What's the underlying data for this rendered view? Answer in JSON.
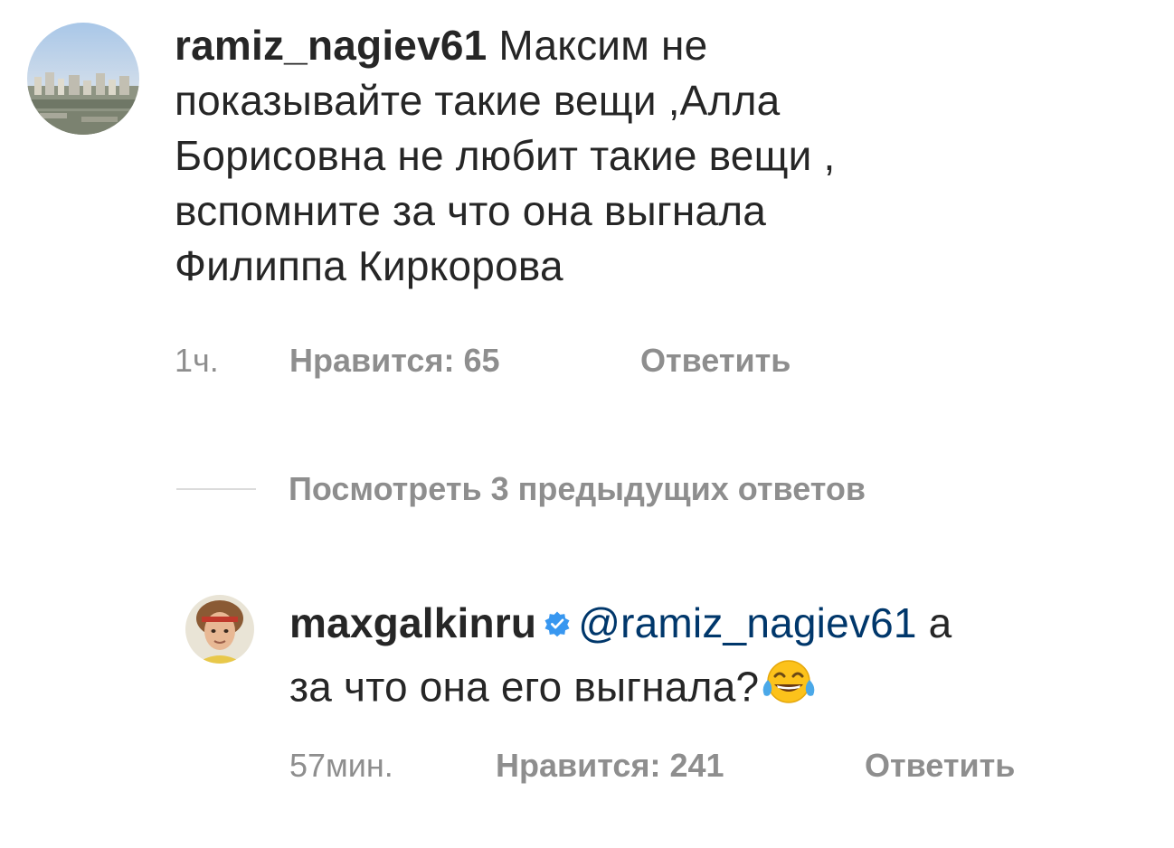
{
  "comment": {
    "username": "ramiz_nagiev61",
    "lines": [
      " Максим не",
      "показывайте такие вещи ,Алла",
      "Борисовна не любит такие вещи ,",
      "вспомните за что она выгнала",
      "Филиппа Киркорова"
    ],
    "time": "1ч.",
    "likes": "Нравится: 65",
    "reply": "Ответить"
  },
  "view_replies": {
    "label": "Посмотреть 3 предыдущих ответов"
  },
  "reply_comment": {
    "username": "maxgalkinru",
    "verified_icon": "verified-badge-icon",
    "mention": "@ramiz_nagiev61",
    "line1_tail": " а",
    "line2": "за что она его выгнала?",
    "emoji_icon": "tears-of-joy-emoji-icon",
    "time": "57мин.",
    "likes": "Нравится: 241",
    "reply": "Ответить"
  },
  "colors": {
    "text": "#262626",
    "secondary": "#8e8e8e",
    "mention": "#00376b",
    "verified": "#3897f0"
  }
}
